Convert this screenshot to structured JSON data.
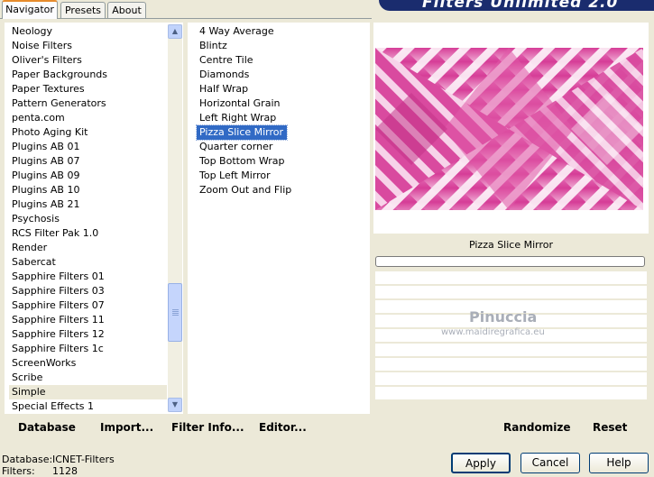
{
  "tabs": [
    "Navigator",
    "Presets",
    "About"
  ],
  "banner_title": "Filters Unlimited 2.0",
  "categories": [
    "Neology",
    "Noise Filters",
    "Oliver's Filters",
    "Paper Backgrounds",
    "Paper Textures",
    "Pattern Generators",
    "penta.com",
    "Photo Aging Kit",
    "Plugins AB 01",
    "Plugins AB 07",
    "Plugins AB 09",
    "Plugins AB 10",
    "Plugins AB 21",
    "Psychosis",
    "RCS Filter Pak 1.0",
    "Render",
    "Sabercat",
    "Sapphire Filters 01",
    "Sapphire Filters 03",
    "Sapphire Filters 07",
    "Sapphire Filters 11",
    "Sapphire Filters 12",
    "Sapphire Filters 1c",
    "ScreenWorks",
    "Scribe",
    "Simple",
    "Special Effects 1"
  ],
  "selected_category": "Simple",
  "filters": [
    "4 Way Average",
    "Blintz",
    "Centre Tile",
    "Diamonds",
    "Half Wrap",
    "Horizontal Grain",
    "Left Right Wrap",
    "Pizza Slice Mirror",
    "Quarter corner",
    "Top Bottom Wrap",
    "Top Left Mirror",
    "Zoom Out and Flip"
  ],
  "selected_filter": "Pizza Slice Mirror",
  "preview_filter_name": "Pizza Slice Mirror",
  "watermark": {
    "line1": "Pinuccia",
    "line2": "www.maidiregrafica.eu"
  },
  "buttons": {
    "database": "Database",
    "import": "Import...",
    "filter_info": "Filter Info...",
    "editor": "Editor...",
    "randomize": "Randomize",
    "reset": "Reset",
    "apply": "Apply",
    "cancel": "Cancel",
    "help": "Help"
  },
  "status": {
    "database_label": "Database:",
    "database_value": "ICNET-Filters",
    "filters_label": "Filters:",
    "filters_value": "1128"
  },
  "colors": {
    "selection": "#316ac5",
    "banner": "#1a2c6e",
    "preview_pink": "#d63d97"
  }
}
